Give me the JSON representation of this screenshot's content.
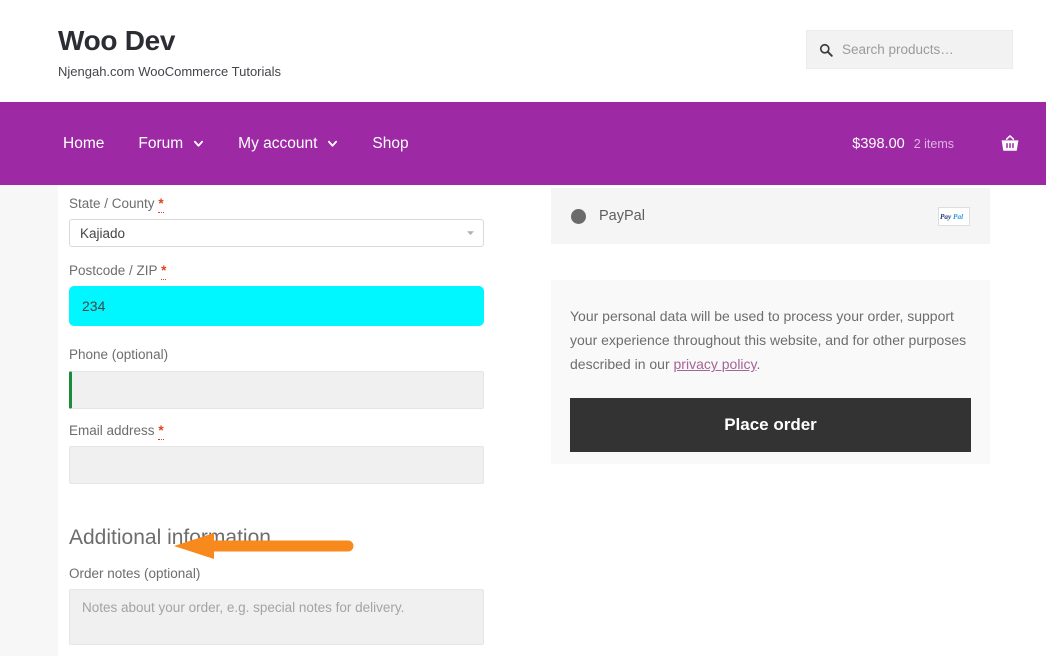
{
  "header": {
    "brand_title": "Woo Dev",
    "tagline": "Njengah.com WooCommerce Tutorials",
    "search_placeholder": "Search products…",
    "search_value": ""
  },
  "nav": {
    "items": [
      {
        "label": "Home",
        "has_dropdown": false
      },
      {
        "label": "Forum",
        "has_dropdown": true
      },
      {
        "label": "My account",
        "has_dropdown": true
      },
      {
        "label": "Shop",
        "has_dropdown": false
      }
    ],
    "cart": {
      "total": "$398.00",
      "item_count": "2 items",
      "icon": "shopping-basket-icon"
    },
    "background_color": "#9e29a5"
  },
  "billing": {
    "state": {
      "label": "State / County",
      "required_mark": "*",
      "value": "Kajiado"
    },
    "postcode": {
      "label": "Postcode / ZIP",
      "required_mark": "*",
      "value": "234",
      "highlight_color": "#00f7ff"
    },
    "phone": {
      "label": "Phone (optional)",
      "value": "",
      "placeholder": "",
      "focus_border_color": "#1c8c3c"
    },
    "email": {
      "label": "Email address",
      "required_mark": "*",
      "value": "",
      "placeholder": ""
    }
  },
  "additional": {
    "heading": "Additional information",
    "order_notes": {
      "label": "Order notes (optional)",
      "value": "",
      "placeholder": "Notes about your order, e.g. special notes for delivery."
    }
  },
  "payment": {
    "method_label": "PayPal",
    "selected": true,
    "badge_pay": "Pay",
    "badge_pal": "Pal"
  },
  "privacy": {
    "text_before": "Your personal data will be used to process your order, support your experience throughout this website, and for other purposes described in our ",
    "link_text": "privacy policy",
    "text_after": ".",
    "link_color": "#a46497"
  },
  "order": {
    "place_order_label": "Place order",
    "button_color": "#333333"
  },
  "annotation": {
    "type": "arrow",
    "direction": "left",
    "color": "#f7891d",
    "points_at": "Phone (optional)"
  }
}
